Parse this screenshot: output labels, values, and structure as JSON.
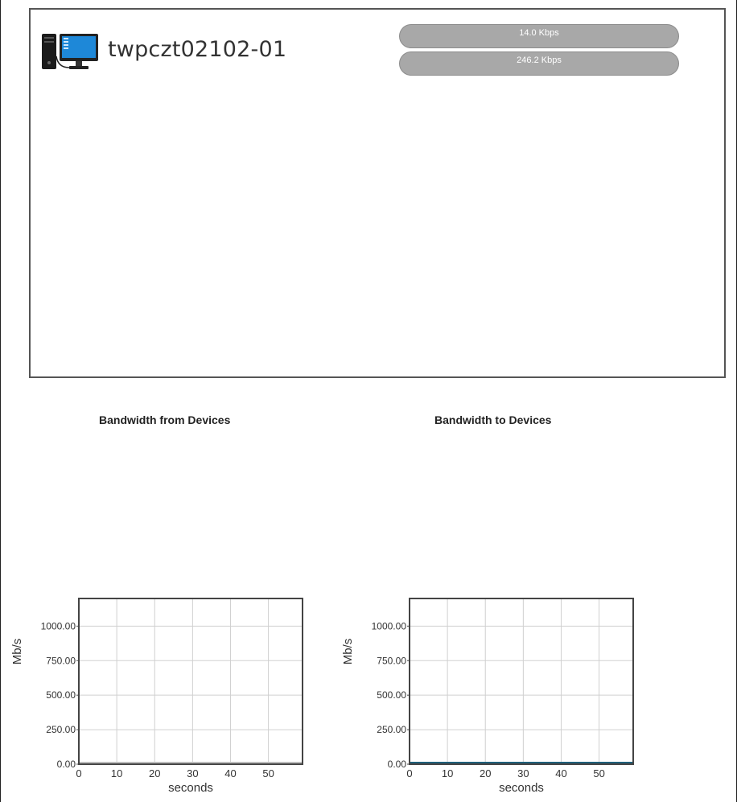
{
  "device": {
    "name": "twpczt02102-01",
    "icon": "desktop-computer-icon",
    "speed_up": "14.0 Kbps",
    "speed_down": "246.2 Kbps"
  },
  "charts": {
    "from_title": "Bandwidth from Devices",
    "to_title": "Bandwidth to Devices"
  },
  "chart_data": [
    {
      "type": "line",
      "title": "Bandwidth from Devices",
      "xlabel": "seconds",
      "ylabel": "Mb/s",
      "xlim": [
        0,
        59
      ],
      "ylim": [
        0,
        1200
      ],
      "x_ticks": [
        0,
        10,
        20,
        30,
        40,
        50
      ],
      "y_ticks": [
        0,
        250,
        500,
        750,
        1000
      ],
      "y_tick_labels": [
        "0.00",
        "250.00",
        "500.00",
        "750.00",
        "1000.00"
      ],
      "grid": true,
      "series_color": "#bdbdbd",
      "series": [
        {
          "x": [
            0,
            59
          ],
          "values": [
            0,
            0
          ]
        }
      ]
    },
    {
      "type": "line",
      "title": "Bandwidth to Devices",
      "xlabel": "seconds",
      "ylabel": "Mb/s",
      "xlim": [
        0,
        59
      ],
      "ylim": [
        0,
        1200
      ],
      "x_ticks": [
        0,
        10,
        20,
        30,
        40,
        50
      ],
      "y_ticks": [
        0,
        250,
        500,
        750,
        1000
      ],
      "y_tick_labels": [
        "0.00",
        "250.00",
        "500.00",
        "750.00",
        "1000.00"
      ],
      "grid": true,
      "series_color": "#1f5f7a",
      "series": [
        {
          "x": [
            0,
            59
          ],
          "values": [
            0,
            0
          ]
        }
      ]
    }
  ]
}
